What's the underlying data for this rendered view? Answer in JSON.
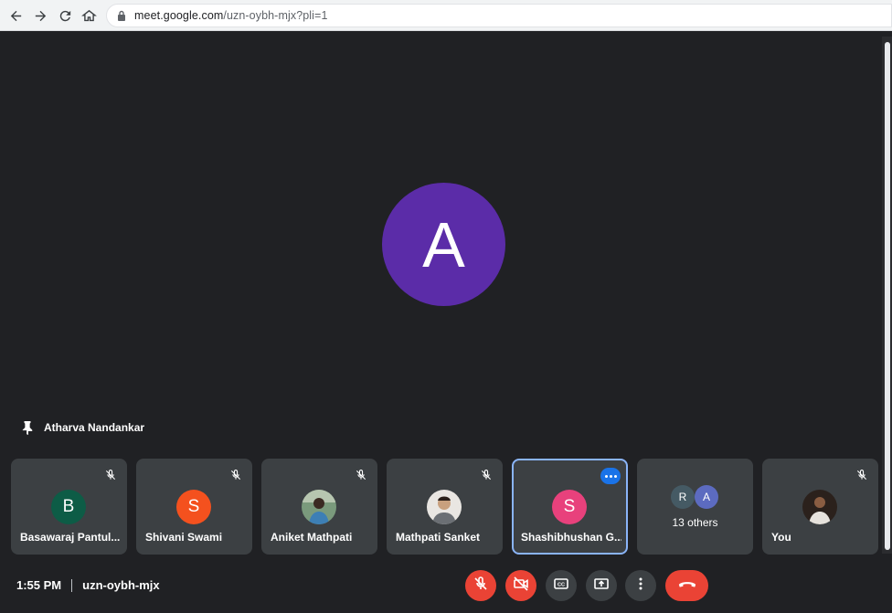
{
  "browser": {
    "url_host": "meet.google.com",
    "url_path": "/uzn-oybh-mjx?pli=1"
  },
  "stage": {
    "main_avatar_letter": "A",
    "main_avatar_color": "#5b2ca8",
    "pinned_name": "Atharva Nandankar"
  },
  "tiles": [
    {
      "name": "Basawaraj Pantul...",
      "initial": "B",
      "avatar_color": "#0d5c46",
      "muted": true
    },
    {
      "name": "Shivani Swami",
      "initial": "S",
      "avatar_color": "#f4511e",
      "muted": true
    },
    {
      "name": "Aniket Mathpati",
      "initial": "",
      "avatar_type": "photo",
      "muted": true
    },
    {
      "name": "Mathpati Sanket",
      "initial": "",
      "avatar_type": "photo",
      "muted": true
    },
    {
      "name": "Shashibhushan G...",
      "initial": "S",
      "avatar_color": "#e8417c",
      "muted": false,
      "active": true
    },
    {
      "name": "You",
      "initial": "",
      "avatar_type": "photo",
      "muted": true
    }
  ],
  "others": {
    "label": "13 others",
    "avatar1": "R",
    "avatar1_color": "#455a64",
    "avatar2": "A",
    "avatar2_color": "#5c6bc0"
  },
  "bottom": {
    "time": "1:55 PM",
    "meeting_code": "uzn-oybh-mjx"
  },
  "icons": {
    "back": "arrow-left-icon",
    "forward": "arrow-right-icon",
    "reload": "reload-icon",
    "home": "home-icon",
    "lock": "lock-icon",
    "mic_off": "mic-off-icon",
    "camera_off": "camera-off-icon",
    "captions": "captions-icon",
    "present": "present-screen-icon",
    "more": "more-vert-icon",
    "end_call": "end-call-icon"
  },
  "colors": {
    "accent_red": "#ea4335",
    "active_border": "#8ab4f8",
    "tile_bg": "#3c4043"
  }
}
